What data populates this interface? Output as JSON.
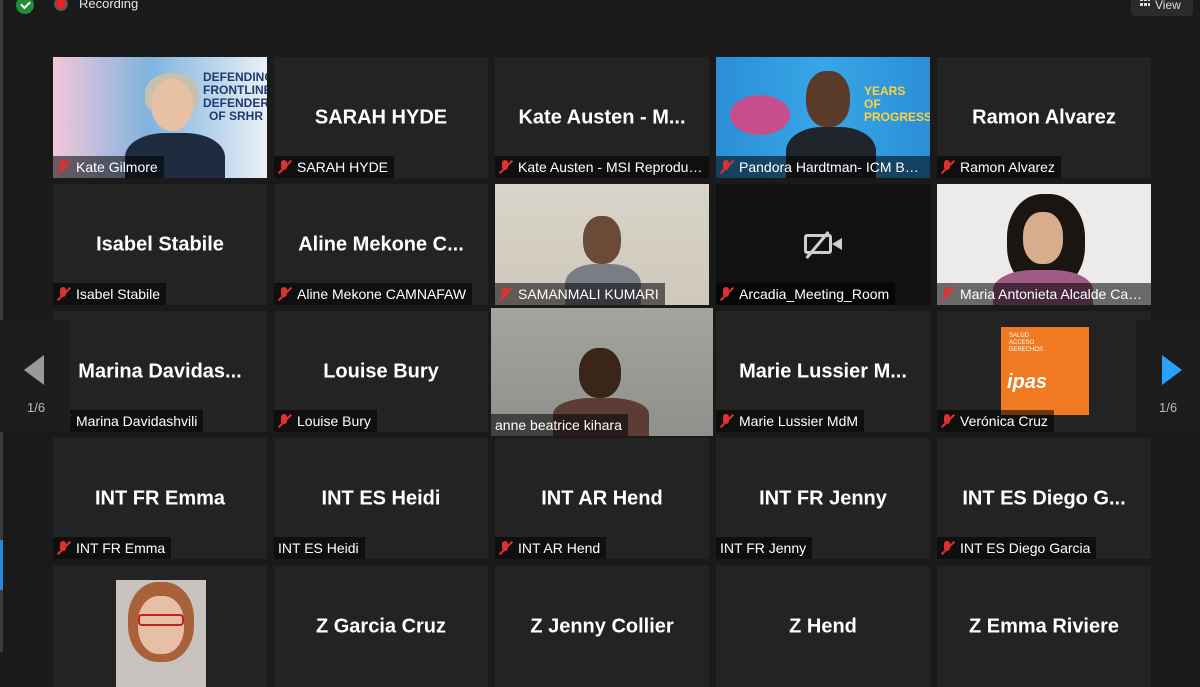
{
  "topbar": {
    "recording_label": "Recording",
    "view_label": "View"
  },
  "navigation": {
    "page_indicator_left": "1/6",
    "page_indicator_right": "1/6"
  },
  "tiles": [
    {
      "big": "",
      "label": "Kate Gilmore",
      "video": "kate"
    },
    {
      "big": "SARAH HYDE",
      "label": "SARAH HYDE"
    },
    {
      "big": "Kate Austen - M...",
      "label": "Kate Austen - MSI Reproduct..."
    },
    {
      "big": "",
      "label": "Pandora Hardtman- ICM Boa...",
      "video": "pandora"
    },
    {
      "big": "Ramon Alvarez",
      "label": "Ramon Alvarez"
    },
    {
      "big": "Isabel Stabile",
      "label": "Isabel Stabile"
    },
    {
      "big": "Aline Mekone C...",
      "label": "Aline Mekone CAMNAFAW"
    },
    {
      "big": "",
      "label": "SAMANMALI KUMARI",
      "video": "saman"
    },
    {
      "big": "",
      "label": "Arcadia_Meeting_Room",
      "video": "camoff"
    },
    {
      "big": "",
      "label": "Maria Antonieta Alcalde Cast...",
      "video": "maria"
    },
    {
      "big": "Marina  Davidas...",
      "label": "Marina Davidashvili"
    },
    {
      "big": "Louise Bury",
      "label": "Louise Bury"
    },
    {
      "big": "",
      "label": "anne beatrice kihara",
      "video": "anne"
    },
    {
      "big": "Marie  Lussier  M...",
      "label": "Marie Lussier MdM"
    },
    {
      "big": "",
      "label": "Verónica Cruz",
      "video": "ipas"
    },
    {
      "big": "INT FR Emma",
      "label": "INT FR Emma"
    },
    {
      "big": "INT ES Heidi",
      "label": "INT ES Heidi"
    },
    {
      "big": "INT AR Hend",
      "label": "INT AR Hend"
    },
    {
      "big": "INT FR Jenny",
      "label": "INT FR Jenny"
    },
    {
      "big": "INT ES Diego G...",
      "label": "INT ES Diego Garcia"
    },
    {
      "big": "",
      "label": "",
      "video": "lastphoto"
    },
    {
      "big": "Z Garcia Cruz",
      "label": ""
    },
    {
      "big": "Z Jenny Collier",
      "label": ""
    },
    {
      "big": "Z Hend",
      "label": ""
    },
    {
      "big": "Z Emma Riviere",
      "label": ""
    }
  ],
  "slides": {
    "kate_slide_text": "DEFENDING FRONTLINE DEFENDERS OF SRHR",
    "pandora_slide_text": "YEARS OF PROGRESS",
    "ipas_text": "ipas",
    "ipas_small_text": "SALUD ACCESO DERECHOS"
  }
}
